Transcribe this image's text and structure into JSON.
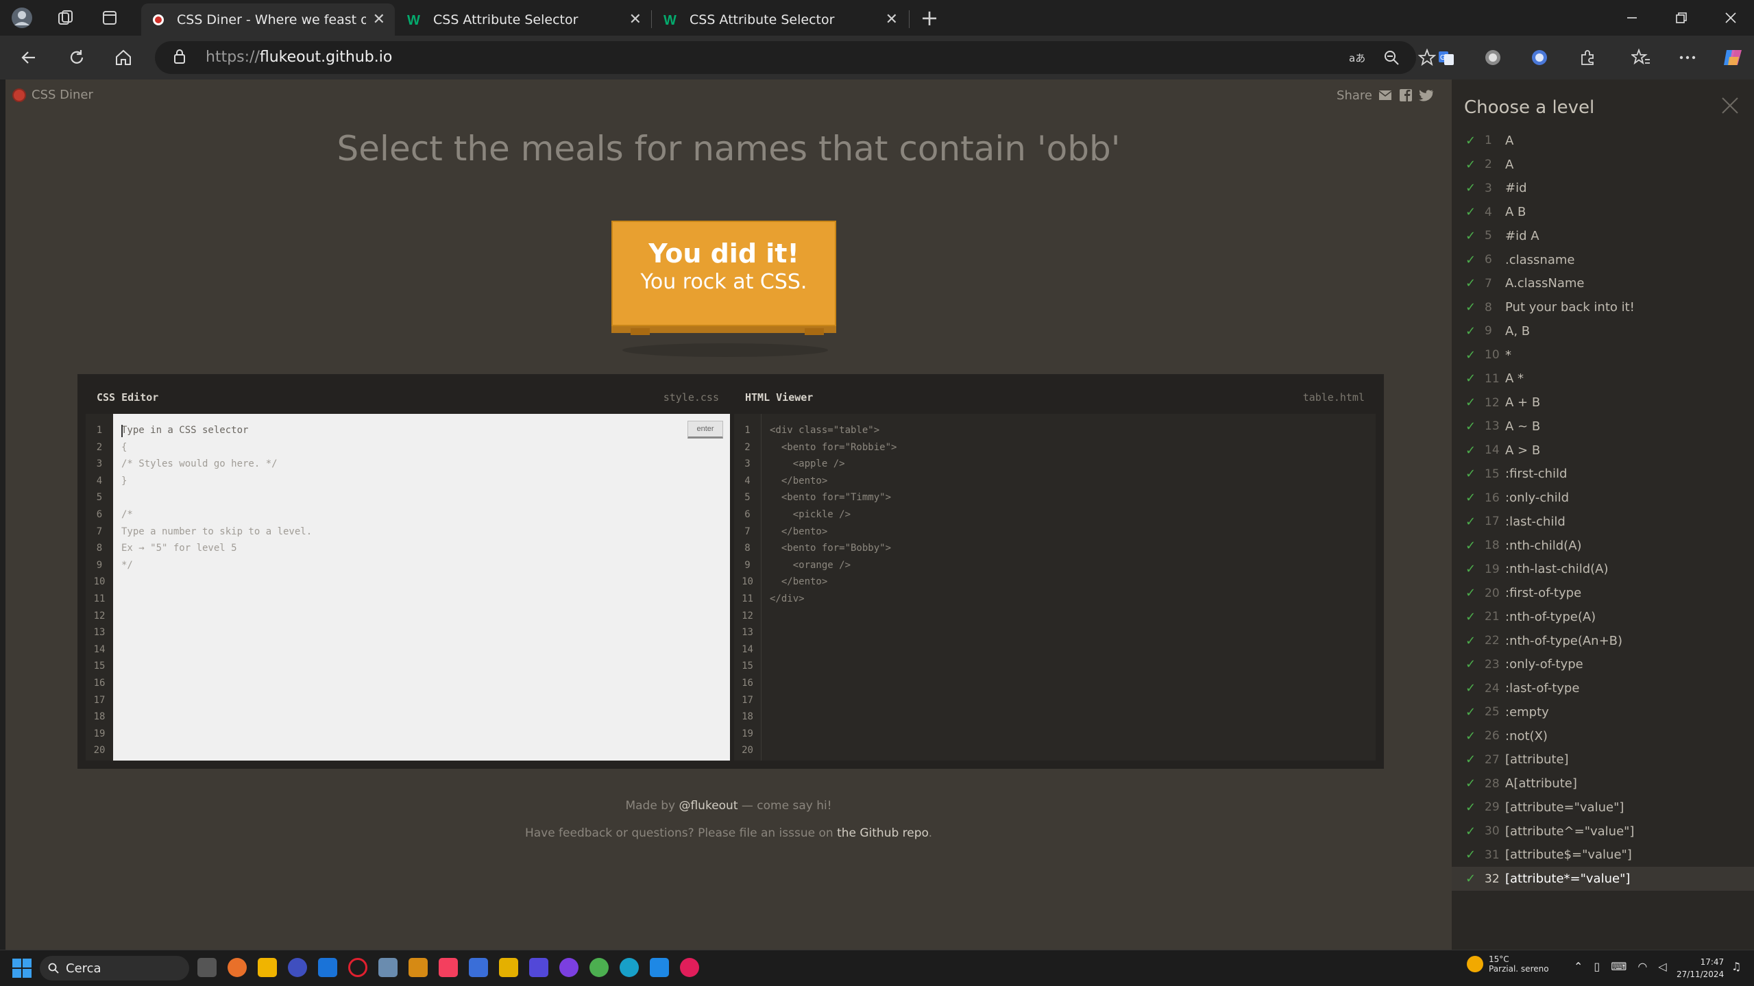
{
  "browser": {
    "tabs": [
      {
        "title": "CSS Diner - Where we feast on CSS",
        "favicon": "css-diner-favicon",
        "active": true
      },
      {
        "title": "CSS Attribute Selector",
        "favicon": "w3schools-favicon",
        "active": false
      },
      {
        "title": "CSS Attribute Selector",
        "favicon": "w3schools-favicon",
        "active": false
      }
    ],
    "url_prefix": "https://",
    "url_host": "flukeout.github.io",
    "tab_close_symbol": "✕",
    "new_tab_symbol": "+"
  },
  "page": {
    "brand": "CSS Diner",
    "share_label": "Share",
    "order_text": "Select the meals for names that contain 'obb'",
    "table_message_line1": "You did it!",
    "table_message_line2": "You rock at CSS.",
    "css_editor": {
      "title": "CSS Editor",
      "filename": "style.css",
      "enter_label": "enter",
      "lines": [
        "Type in a CSS selector",
        "{",
        "/* Styles would go here. */",
        "}",
        "",
        "/*",
        "Type a number to skip to a level.",
        "Ex → \"5\" for level 5",
        "*/"
      ],
      "line_numbers": [
        "1",
        "2",
        "3",
        "4",
        "5",
        "6",
        "7",
        "8",
        "9",
        "10",
        "11",
        "12",
        "13",
        "14",
        "15",
        "16",
        "17",
        "18",
        "19",
        "20"
      ]
    },
    "html_viewer": {
      "title": "HTML Viewer",
      "filename": "table.html",
      "lines": [
        "<div class=\"table\">",
        "  <bento for=\"Robbie\">",
        "    <apple />",
        "  </bento>",
        "  <bento for=\"Timmy\">",
        "    <pickle />",
        "  </bento>",
        "  <bento for=\"Bobby\">",
        "    <orange />",
        "  </bento>",
        "</div>"
      ],
      "line_numbers": [
        "1",
        "2",
        "3",
        "4",
        "5",
        "6",
        "7",
        "8",
        "9",
        "10",
        "11",
        "12",
        "13",
        "14",
        "15",
        "16",
        "17",
        "18",
        "19",
        "20"
      ]
    },
    "footer": {
      "made_by_prefix": "Made by ",
      "made_by_link": "@flukeout",
      "made_by_suffix": " — come say hi!",
      "feedback_prefix": "Have feedback or questions? Please file an isssue on ",
      "feedback_link": "the Github repo",
      "feedback_suffix": "."
    }
  },
  "sidebar": {
    "title": "Choose a level",
    "check_symbol": "✓",
    "current_level": 32,
    "levels": [
      {
        "num": "1",
        "selector": "A"
      },
      {
        "num": "2",
        "selector": "A"
      },
      {
        "num": "3",
        "selector": "#id"
      },
      {
        "num": "4",
        "selector": "A B"
      },
      {
        "num": "5",
        "selector": "#id A"
      },
      {
        "num": "6",
        "selector": ".classname"
      },
      {
        "num": "7",
        "selector": "A.className"
      },
      {
        "num": "8",
        "selector": "Put your back into it!"
      },
      {
        "num": "9",
        "selector": "A, B"
      },
      {
        "num": "10",
        "selector": "*"
      },
      {
        "num": "11",
        "selector": "A *"
      },
      {
        "num": "12",
        "selector": "A + B"
      },
      {
        "num": "13",
        "selector": "A ~ B"
      },
      {
        "num": "14",
        "selector": "A > B"
      },
      {
        "num": "15",
        "selector": ":first-child"
      },
      {
        "num": "16",
        "selector": ":only-child"
      },
      {
        "num": "17",
        "selector": ":last-child"
      },
      {
        "num": "18",
        "selector": ":nth-child(A)"
      },
      {
        "num": "19",
        "selector": ":nth-last-child(A)"
      },
      {
        "num": "20",
        "selector": ":first-of-type"
      },
      {
        "num": "21",
        "selector": ":nth-of-type(A)"
      },
      {
        "num": "22",
        "selector": ":nth-of-type(An+B)"
      },
      {
        "num": "23",
        "selector": ":only-of-type"
      },
      {
        "num": "24",
        "selector": ":last-of-type"
      },
      {
        "num": "25",
        "selector": ":empty"
      },
      {
        "num": "26",
        "selector": ":not(X)"
      },
      {
        "num": "27",
        "selector": "[attribute]"
      },
      {
        "num": "28",
        "selector": "A[attribute]"
      },
      {
        "num": "29",
        "selector": "[attribute=\"value\"]"
      },
      {
        "num": "30",
        "selector": "[attribute^=\"value\"]"
      },
      {
        "num": "31",
        "selector": "[attribute$=\"value\"]"
      },
      {
        "num": "32",
        "selector": "[attribute*=\"value\"]"
      }
    ]
  },
  "taskbar": {
    "search_label": "Cerca",
    "weather_temp": "15°C",
    "weather_desc": "Parzial. sereno",
    "time": "17:47",
    "date": "27/11/2024"
  },
  "colors": {
    "table_orange": "#e8a030",
    "check_green": "#4cae4c",
    "page_bg": "#3e3a34"
  }
}
